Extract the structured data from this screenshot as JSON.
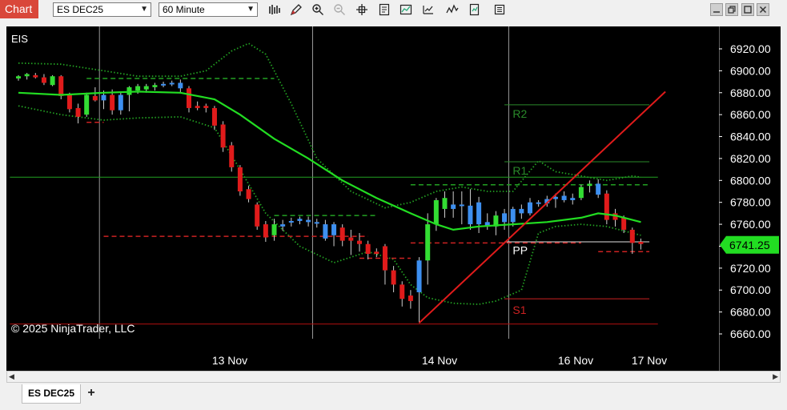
{
  "app": {
    "tab_label": "Chart"
  },
  "toolbar": {
    "symbol": "ES DEC25",
    "interval": "60 Minute",
    "icons": [
      "bars-icon",
      "pencil-icon",
      "zoom-in-icon",
      "zoom-out-icon",
      "crosshair-icon",
      "properties-icon",
      "strategy-icon",
      "indicator-icon",
      "chart-trader-icon",
      "copy-icon",
      "share-icon"
    ]
  },
  "window_controls": [
    "minimize-icon",
    "restore-icon",
    "maximize-icon",
    "close-icon"
  ],
  "chart": {
    "instrument_label": "EIS",
    "copyright": "© 2025 NinjaTrader, LLC",
    "last_price_label": "6741.25",
    "colors": {
      "background": "#000000",
      "up_bar": "#33dd33",
      "down_bar": "#e01b1b",
      "neutral_bar": "#3d8ff0",
      "moving_average": "#22dd22",
      "bands": "#22a022",
      "pivot_resistance": "#2a8a2a",
      "pivot_support": "#cc2222",
      "trend_line": "#e01b1b",
      "price_marker": "#22dd22"
    },
    "pivots": [
      {
        "label": "R2",
        "price": 6869
      },
      {
        "label": "R1",
        "price": 6817
      },
      {
        "label": "PP",
        "price": 6745
      },
      {
        "label": "S1",
        "price": 6692
      }
    ]
  },
  "chart_data": {
    "type": "candlestick",
    "y_axis": {
      "min": 6660,
      "max": 6920,
      "step": 20,
      "ticks": [
        "6920.00",
        "6900.00",
        "6880.00",
        "6860.00",
        "6840.00",
        "6820.00",
        "6800.00",
        "6780.00",
        "6760.00",
        "6740.00",
        "6720.00",
        "6700.00",
        "6680.00",
        "6660.00"
      ]
    },
    "x_axis": {
      "labels": [
        "13 Nov",
        "14 Nov",
        "16 Nov",
        "17 Nov"
      ]
    },
    "last_price": 6741.25,
    "candles": [
      {
        "o": 6893,
        "h": 6896,
        "l": 6891,
        "c": 6895,
        "k": "u"
      },
      {
        "o": 6895,
        "h": 6898,
        "l": 6892,
        "c": 6897,
        "k": "u"
      },
      {
        "o": 6896,
        "h": 6898,
        "l": 6893,
        "c": 6894,
        "k": "d"
      },
      {
        "o": 6894,
        "h": 6897,
        "l": 6887,
        "c": 6889,
        "k": "d"
      },
      {
        "o": 6887,
        "h": 6896,
        "l": 6886,
        "c": 6895,
        "k": "u"
      },
      {
        "o": 6895,
        "h": 6896,
        "l": 6874,
        "c": 6877,
        "k": "d"
      },
      {
        "o": 6878,
        "h": 6880,
        "l": 6862,
        "c": 6865,
        "k": "d"
      },
      {
        "o": 6866,
        "h": 6870,
        "l": 6852,
        "c": 6858,
        "k": "d"
      },
      {
        "o": 6860,
        "h": 6880,
        "l": 6858,
        "c": 6878,
        "k": "u"
      },
      {
        "o": 6877,
        "h": 6885,
        "l": 6872,
        "c": 6873,
        "k": "d"
      },
      {
        "o": 6873,
        "h": 6882,
        "l": 6865,
        "c": 6878,
        "k": "n"
      },
      {
        "o": 6878,
        "h": 6883,
        "l": 6860,
        "c": 6864,
        "k": "d"
      },
      {
        "o": 6864,
        "h": 6880,
        "l": 6860,
        "c": 6878,
        "k": "n"
      },
      {
        "o": 6878,
        "h": 6886,
        "l": 6863,
        "c": 6885,
        "k": "u"
      },
      {
        "o": 6882,
        "h": 6888,
        "l": 6879,
        "c": 6886,
        "k": "u"
      },
      {
        "o": 6883,
        "h": 6888,
        "l": 6880,
        "c": 6886,
        "k": "u"
      },
      {
        "o": 6885,
        "h": 6889,
        "l": 6882,
        "c": 6887,
        "k": "u"
      },
      {
        "o": 6887,
        "h": 6890,
        "l": 6885,
        "c": 6888,
        "k": "n"
      },
      {
        "o": 6888,
        "h": 6891,
        "l": 6886,
        "c": 6889,
        "k": "n"
      },
      {
        "o": 6889,
        "h": 6892,
        "l": 6880,
        "c": 6884,
        "k": "n"
      },
      {
        "o": 6884,
        "h": 6886,
        "l": 6862,
        "c": 6866,
        "k": "d"
      },
      {
        "o": 6866,
        "h": 6872,
        "l": 6864,
        "c": 6868,
        "k": "d"
      },
      {
        "o": 6868,
        "h": 6870,
        "l": 6862,
        "c": 6866,
        "k": "d"
      },
      {
        "o": 6866,
        "h": 6868,
        "l": 6846,
        "c": 6850,
        "k": "d"
      },
      {
        "o": 6851,
        "h": 6854,
        "l": 6826,
        "c": 6830,
        "k": "d"
      },
      {
        "o": 6832,
        "h": 6835,
        "l": 6808,
        "c": 6812,
        "k": "d"
      },
      {
        "o": 6812,
        "h": 6814,
        "l": 6786,
        "c": 6790,
        "k": "d"
      },
      {
        "o": 6792,
        "h": 6795,
        "l": 6780,
        "c": 6783,
        "k": "d"
      },
      {
        "o": 6778,
        "h": 6780,
        "l": 6755,
        "c": 6758,
        "k": "d"
      },
      {
        "o": 6760,
        "h": 6763,
        "l": 6744,
        "c": 6748,
        "k": "d"
      },
      {
        "o": 6750,
        "h": 6765,
        "l": 6745,
        "c": 6760,
        "k": "u"
      },
      {
        "o": 6760,
        "h": 6764,
        "l": 6754,
        "c": 6758,
        "k": "n"
      },
      {
        "o": 6762,
        "h": 6766,
        "l": 6758,
        "c": 6763,
        "k": "n"
      },
      {
        "o": 6763,
        "h": 6767,
        "l": 6760,
        "c": 6765,
        "k": "n"
      },
      {
        "o": 6764,
        "h": 6767,
        "l": 6758,
        "c": 6762,
        "k": "n"
      },
      {
        "o": 6762,
        "h": 6765,
        "l": 6757,
        "c": 6761,
        "k": "n"
      },
      {
        "o": 6760,
        "h": 6764,
        "l": 6745,
        "c": 6747,
        "k": "n"
      },
      {
        "o": 6750,
        "h": 6762,
        "l": 6740,
        "c": 6760,
        "k": "n"
      },
      {
        "o": 6757,
        "h": 6760,
        "l": 6740,
        "c": 6745,
        "k": "d"
      },
      {
        "o": 6745,
        "h": 6755,
        "l": 6732,
        "c": 6748,
        "k": "d"
      },
      {
        "o": 6745,
        "h": 6752,
        "l": 6735,
        "c": 6742,
        "k": "d"
      },
      {
        "o": 6742,
        "h": 6745,
        "l": 6728,
        "c": 6733,
        "k": "d"
      },
      {
        "o": 6735,
        "h": 6738,
        "l": 6730,
        "c": 6733,
        "k": "d"
      },
      {
        "o": 6740,
        "h": 6742,
        "l": 6705,
        "c": 6718,
        "k": "d"
      },
      {
        "o": 6718,
        "h": 6722,
        "l": 6698,
        "c": 6705,
        "k": "d"
      },
      {
        "o": 6705,
        "h": 6708,
        "l": 6685,
        "c": 6692,
        "k": "d"
      },
      {
        "o": 6695,
        "h": 6700,
        "l": 6683,
        "c": 6690,
        "k": "d"
      },
      {
        "o": 6698,
        "h": 6730,
        "l": 6670,
        "c": 6727,
        "k": "n"
      },
      {
        "o": 6727,
        "h": 6770,
        "l": 6705,
        "c": 6760,
        "k": "u"
      },
      {
        "o": 6760,
        "h": 6784,
        "l": 6754,
        "c": 6782,
        "k": "u"
      },
      {
        "o": 6784,
        "h": 6790,
        "l": 6766,
        "c": 6774,
        "k": "u"
      },
      {
        "o": 6774,
        "h": 6790,
        "l": 6766,
        "c": 6778,
        "k": "n"
      },
      {
        "o": 6778,
        "h": 6790,
        "l": 6760,
        "c": 6777,
        "k": "n"
      },
      {
        "o": 6777,
        "h": 6792,
        "l": 6755,
        "c": 6760,
        "k": "n"
      },
      {
        "o": 6760,
        "h": 6785,
        "l": 6752,
        "c": 6780,
        "k": "n"
      },
      {
        "o": 6762,
        "h": 6770,
        "l": 6755,
        "c": 6758,
        "k": "n"
      },
      {
        "o": 6758,
        "h": 6772,
        "l": 6750,
        "c": 6768,
        "k": "u"
      },
      {
        "o": 6770,
        "h": 6774,
        "l": 6755,
        "c": 6762,
        "k": "n"
      },
      {
        "o": 6762,
        "h": 6776,
        "l": 6758,
        "c": 6774,
        "k": "n"
      },
      {
        "o": 6774,
        "h": 6778,
        "l": 6765,
        "c": 6770,
        "k": "n"
      },
      {
        "o": 6770,
        "h": 6784,
        "l": 6768,
        "c": 6780,
        "k": "n"
      },
      {
        "o": 6780,
        "h": 6782,
        "l": 6776,
        "c": 6779,
        "k": "n"
      },
      {
        "o": 6779,
        "h": 6786,
        "l": 6776,
        "c": 6783,
        "k": "n"
      },
      {
        "o": 6783,
        "h": 6788,
        "l": 6775,
        "c": 6785,
        "k": "n"
      },
      {
        "o": 6786,
        "h": 6790,
        "l": 6780,
        "c": 6782,
        "k": "n"
      },
      {
        "o": 6782,
        "h": 6788,
        "l": 6778,
        "c": 6784,
        "k": "n"
      },
      {
        "o": 6784,
        "h": 6796,
        "l": 6782,
        "c": 6794,
        "k": "u"
      },
      {
        "o": 6795,
        "h": 6800,
        "l": 6789,
        "c": 6797,
        "k": "u"
      },
      {
        "o": 6797,
        "h": 6801,
        "l": 6784,
        "c": 6787,
        "k": "n"
      },
      {
        "o": 6788,
        "h": 6791,
        "l": 6760,
        "c": 6764,
        "k": "d"
      },
      {
        "o": 6770,
        "h": 6774,
        "l": 6758,
        "c": 6764,
        "k": "d"
      },
      {
        "o": 6766,
        "h": 6768,
        "l": 6752,
        "c": 6755,
        "k": "d"
      },
      {
        "o": 6755,
        "h": 6757,
        "l": 6733,
        "c": 6743,
        "k": "d"
      },
      {
        "o": 6744,
        "h": 6747,
        "l": 6737,
        "c": 6742,
        "k": "d"
      }
    ],
    "moving_average": [
      [
        0,
        6880
      ],
      [
        5,
        6878
      ],
      [
        10,
        6880
      ],
      [
        14,
        6881
      ],
      [
        19,
        6880
      ],
      [
        23,
        6874
      ],
      [
        26,
        6860
      ],
      [
        30,
        6838
      ],
      [
        34,
        6820
      ],
      [
        38,
        6800
      ],
      [
        42,
        6784
      ],
      [
        46,
        6770
      ],
      [
        49,
        6760
      ],
      [
        51,
        6755
      ],
      [
        54,
        6758
      ],
      [
        58,
        6760
      ],
      [
        62,
        6762
      ],
      [
        66,
        6766
      ],
      [
        68,
        6770
      ],
      [
        70,
        6768
      ],
      [
        73,
        6762
      ]
    ],
    "upper_band": [
      [
        0,
        6907
      ],
      [
        5,
        6906
      ],
      [
        10,
        6900
      ],
      [
        14,
        6895
      ],
      [
        19,
        6895
      ],
      [
        22,
        6900
      ],
      [
        25,
        6918
      ],
      [
        27,
        6925
      ],
      [
        29,
        6915
      ],
      [
        32,
        6870
      ],
      [
        35,
        6820
      ],
      [
        39,
        6790
      ],
      [
        43,
        6775
      ],
      [
        46,
        6780
      ],
      [
        49,
        6790
      ],
      [
        52,
        6794
      ],
      [
        55,
        6790
      ],
      [
        58,
        6790
      ],
      [
        61,
        6818
      ],
      [
        63,
        6808
      ],
      [
        66,
        6804
      ],
      [
        69,
        6800
      ],
      [
        72,
        6804
      ],
      [
        73,
        6803
      ]
    ],
    "lower_band": [
      [
        0,
        6868
      ],
      [
        5,
        6860
      ],
      [
        10,
        6855
      ],
      [
        14,
        6857
      ],
      [
        19,
        6858
      ],
      [
        23,
        6848
      ],
      [
        26,
        6810
      ],
      [
        29,
        6770
      ],
      [
        33,
        6740
      ],
      [
        37,
        6725
      ],
      [
        41,
        6735
      ],
      [
        44,
        6728
      ],
      [
        46,
        6705
      ],
      [
        48,
        6693
      ],
      [
        51,
        6688
      ],
      [
        54,
        6687
      ],
      [
        56,
        6690
      ],
      [
        59,
        6700
      ],
      [
        61,
        6752
      ],
      [
        63,
        6758
      ],
      [
        66,
        6760
      ],
      [
        69,
        6758
      ],
      [
        72,
        6752
      ],
      [
        73,
        6750
      ]
    ],
    "vertical_lines_at_bar": [
      9.5,
      34.5,
      57.5
    ],
    "horizontal_lines": [
      {
        "price": 6803,
        "style": "solid",
        "color": "#22a022",
        "from": -1,
        "to": 75
      },
      {
        "price": 6669,
        "style": "solid",
        "color": "#b01010",
        "from": -1,
        "to": 75
      },
      {
        "price": 6744,
        "style": "solid",
        "color": "#e0e0e0",
        "from": 57,
        "to": 74
      }
    ],
    "dashed_segments": [
      {
        "price": 6893,
        "color": "#22a022",
        "from": 8,
        "to": 30
      },
      {
        "price": 6853,
        "color": "#cc2222",
        "from": 8,
        "to": 10
      },
      {
        "price": 6749,
        "color": "#cc2222",
        "from": 10,
        "to": 41
      },
      {
        "price": 6768,
        "color": "#22a022",
        "from": 30,
        "to": 42
      },
      {
        "price": 6729,
        "color": "#cc2222",
        "from": 40,
        "to": 46
      },
      {
        "price": 6796,
        "color": "#22a022",
        "from": 46,
        "to": 74
      },
      {
        "price": 6743,
        "color": "#cc2222",
        "from": 46,
        "to": 66
      },
      {
        "price": 6735,
        "color": "#cc2222",
        "from": 68,
        "to": 74
      }
    ],
    "pivot_lines": [
      {
        "price": 6869,
        "color": "#2a8a2a",
        "from": 57,
        "to": 74
      },
      {
        "price": 6817,
        "color": "#2a8a2a",
        "from": 57,
        "to": 74
      },
      {
        "price": 6692,
        "color": "#cc2222",
        "from": 57,
        "to": 74
      }
    ],
    "trend_line": {
      "from": [
        47,
        6670
      ],
      "to": [
        74,
        6870
      ]
    }
  },
  "bottom": {
    "tab_label": "ES DEC25",
    "add_tab_label": "+"
  }
}
